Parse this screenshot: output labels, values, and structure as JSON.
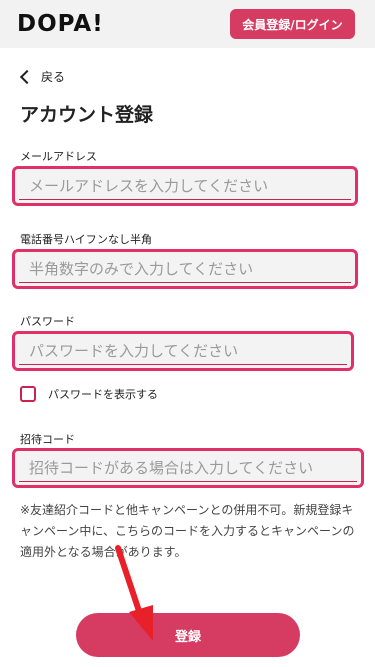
{
  "header": {
    "logo_text": "DOPA!",
    "signup_login_label": "会員登録/ログイン"
  },
  "nav": {
    "back_label": "戻る"
  },
  "page": {
    "title": "アカウント登録"
  },
  "form": {
    "email": {
      "label": "メールアドレス",
      "placeholder": "メールアドレスを入力してください"
    },
    "phone": {
      "label": "電話番号ハイフンなし半角",
      "placeholder": "半角数字のみで入力してください"
    },
    "password": {
      "label": "パスワード",
      "placeholder": "パスワードを入力してください"
    },
    "show_password": {
      "label": "パスワードを表示する",
      "checked": false
    },
    "invite_code": {
      "label": "招待コード",
      "placeholder": "招待コードがある場合は入力してください"
    },
    "note": "※友達紹介コードと他キャンペーンとの併用不可。新規登録キャンペーン中に、こちらのコードを入力するとキャンペーンの適用外となる場合があります。",
    "submit_label": "登録"
  },
  "colors": {
    "brand": "#d63b62",
    "highlight": "#e0306a",
    "annotation_arrow": "#e8202a"
  },
  "icons": {
    "back": "chevron-left-icon",
    "annotation": "red-arrow-icon"
  }
}
